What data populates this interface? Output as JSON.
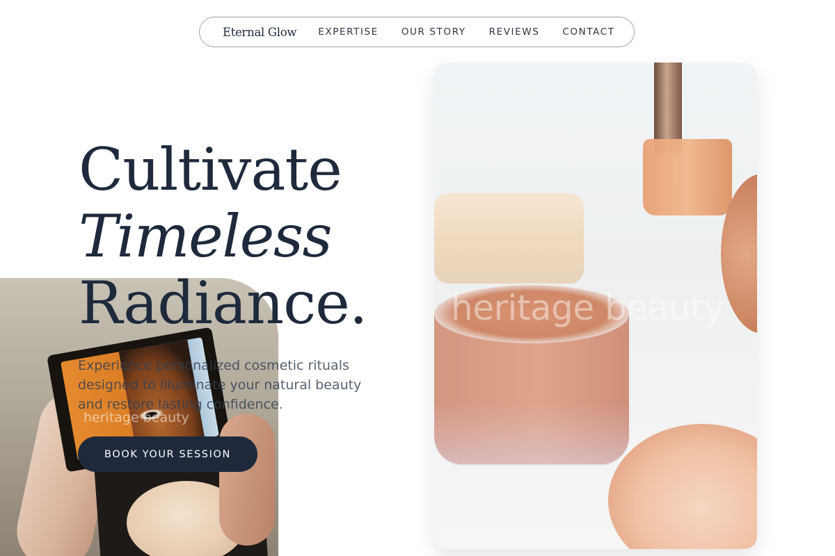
{
  "nav": {
    "brand": "Eternal Glow",
    "links": [
      "EXPERTISE",
      "OUR STORY",
      "REVIEWS",
      "CONTACT"
    ]
  },
  "hero": {
    "headline_line1": "Cultivate",
    "headline_line2": "Timeless",
    "headline_line3": "Radiance.",
    "subtitle": "Experience personalized cosmetic rituals designed to illuminate your natural beauty and restore lasting confidence.",
    "cta_label": "BOOK YOUR SESSION"
  },
  "images": {
    "left_photo_watermark": "heritage beauty",
    "right_photo_watermark": "heritage beauty"
  },
  "colors": {
    "primary": "#1e2a3c",
    "background": "#ffffff",
    "text_muted": "#324054"
  }
}
